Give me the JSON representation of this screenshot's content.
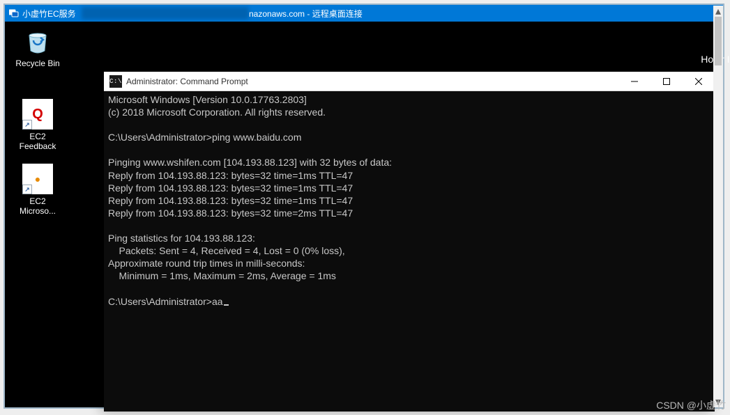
{
  "rdp_bar": {
    "title_left": "小虚竹EC服务",
    "title_mid": "nazonaws.com - 远程桌面连接"
  },
  "desktop": {
    "icons": [
      {
        "type": "recycle",
        "label": "Recycle Bin"
      },
      {
        "type": "shortcut-q",
        "label": "EC2\nFeedback"
      },
      {
        "type": "shortcut-dot",
        "label": "EC2\nMicroso..."
      }
    ],
    "right_panel": "Hostr\nInsta"
  },
  "cmd": {
    "title": "Administrator: Command Prompt",
    "lines": [
      "Microsoft Windows [Version 10.0.17763.2803]",
      "(c) 2018 Microsoft Corporation. All rights reserved.",
      "",
      "C:\\Users\\Administrator>ping www.baidu.com",
      "",
      "Pinging www.wshifen.com [104.193.88.123] with 32 bytes of data:",
      "Reply from 104.193.88.123: bytes=32 time=1ms TTL=47",
      "Reply from 104.193.88.123: bytes=32 time=1ms TTL=47",
      "Reply from 104.193.88.123: bytes=32 time=1ms TTL=47",
      "Reply from 104.193.88.123: bytes=32 time=2ms TTL=47",
      "",
      "Ping statistics for 104.193.88.123:",
      "    Packets: Sent = 4, Received = 4, Lost = 0 (0% loss),",
      "Approximate round trip times in milli-seconds:",
      "    Minimum = 1ms, Maximum = 2ms, Average = 1ms",
      "",
      "C:\\Users\\Administrator>aa"
    ]
  },
  "watermark": "CSDN @小虚竹"
}
